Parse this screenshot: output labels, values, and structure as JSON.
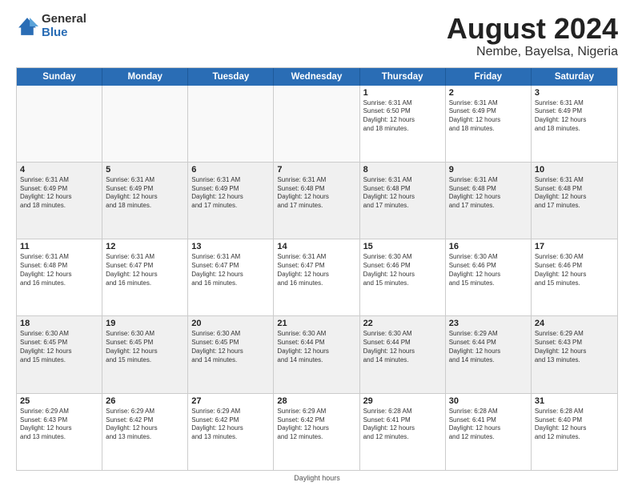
{
  "logo": {
    "general": "General",
    "blue": "Blue"
  },
  "title": "August 2024",
  "subtitle": "Nembe, Bayelsa, Nigeria",
  "days": [
    "Sunday",
    "Monday",
    "Tuesday",
    "Wednesday",
    "Thursday",
    "Friday",
    "Saturday"
  ],
  "footer": "Daylight hours",
  "weeks": [
    [
      {
        "day": "",
        "info": ""
      },
      {
        "day": "",
        "info": ""
      },
      {
        "day": "",
        "info": ""
      },
      {
        "day": "",
        "info": ""
      },
      {
        "day": "1",
        "info": "Sunrise: 6:31 AM\nSunset: 6:50 PM\nDaylight: 12 hours\nand 18 minutes."
      },
      {
        "day": "2",
        "info": "Sunrise: 6:31 AM\nSunset: 6:49 PM\nDaylight: 12 hours\nand 18 minutes."
      },
      {
        "day": "3",
        "info": "Sunrise: 6:31 AM\nSunset: 6:49 PM\nDaylight: 12 hours\nand 18 minutes."
      }
    ],
    [
      {
        "day": "4",
        "info": "Sunrise: 6:31 AM\nSunset: 6:49 PM\nDaylight: 12 hours\nand 18 minutes."
      },
      {
        "day": "5",
        "info": "Sunrise: 6:31 AM\nSunset: 6:49 PM\nDaylight: 12 hours\nand 18 minutes."
      },
      {
        "day": "6",
        "info": "Sunrise: 6:31 AM\nSunset: 6:49 PM\nDaylight: 12 hours\nand 17 minutes."
      },
      {
        "day": "7",
        "info": "Sunrise: 6:31 AM\nSunset: 6:48 PM\nDaylight: 12 hours\nand 17 minutes."
      },
      {
        "day": "8",
        "info": "Sunrise: 6:31 AM\nSunset: 6:48 PM\nDaylight: 12 hours\nand 17 minutes."
      },
      {
        "day": "9",
        "info": "Sunrise: 6:31 AM\nSunset: 6:48 PM\nDaylight: 12 hours\nand 17 minutes."
      },
      {
        "day": "10",
        "info": "Sunrise: 6:31 AM\nSunset: 6:48 PM\nDaylight: 12 hours\nand 17 minutes."
      }
    ],
    [
      {
        "day": "11",
        "info": "Sunrise: 6:31 AM\nSunset: 6:48 PM\nDaylight: 12 hours\nand 16 minutes."
      },
      {
        "day": "12",
        "info": "Sunrise: 6:31 AM\nSunset: 6:47 PM\nDaylight: 12 hours\nand 16 minutes."
      },
      {
        "day": "13",
        "info": "Sunrise: 6:31 AM\nSunset: 6:47 PM\nDaylight: 12 hours\nand 16 minutes."
      },
      {
        "day": "14",
        "info": "Sunrise: 6:31 AM\nSunset: 6:47 PM\nDaylight: 12 hours\nand 16 minutes."
      },
      {
        "day": "15",
        "info": "Sunrise: 6:30 AM\nSunset: 6:46 PM\nDaylight: 12 hours\nand 15 minutes."
      },
      {
        "day": "16",
        "info": "Sunrise: 6:30 AM\nSunset: 6:46 PM\nDaylight: 12 hours\nand 15 minutes."
      },
      {
        "day": "17",
        "info": "Sunrise: 6:30 AM\nSunset: 6:46 PM\nDaylight: 12 hours\nand 15 minutes."
      }
    ],
    [
      {
        "day": "18",
        "info": "Sunrise: 6:30 AM\nSunset: 6:45 PM\nDaylight: 12 hours\nand 15 minutes."
      },
      {
        "day": "19",
        "info": "Sunrise: 6:30 AM\nSunset: 6:45 PM\nDaylight: 12 hours\nand 15 minutes."
      },
      {
        "day": "20",
        "info": "Sunrise: 6:30 AM\nSunset: 6:45 PM\nDaylight: 12 hours\nand 14 minutes."
      },
      {
        "day": "21",
        "info": "Sunrise: 6:30 AM\nSunset: 6:44 PM\nDaylight: 12 hours\nand 14 minutes."
      },
      {
        "day": "22",
        "info": "Sunrise: 6:30 AM\nSunset: 6:44 PM\nDaylight: 12 hours\nand 14 minutes."
      },
      {
        "day": "23",
        "info": "Sunrise: 6:29 AM\nSunset: 6:44 PM\nDaylight: 12 hours\nand 14 minutes."
      },
      {
        "day": "24",
        "info": "Sunrise: 6:29 AM\nSunset: 6:43 PM\nDaylight: 12 hours\nand 13 minutes."
      }
    ],
    [
      {
        "day": "25",
        "info": "Sunrise: 6:29 AM\nSunset: 6:43 PM\nDaylight: 12 hours\nand 13 minutes."
      },
      {
        "day": "26",
        "info": "Sunrise: 6:29 AM\nSunset: 6:42 PM\nDaylight: 12 hours\nand 13 minutes."
      },
      {
        "day": "27",
        "info": "Sunrise: 6:29 AM\nSunset: 6:42 PM\nDaylight: 12 hours\nand 13 minutes."
      },
      {
        "day": "28",
        "info": "Sunrise: 6:29 AM\nSunset: 6:42 PM\nDaylight: 12 hours\nand 12 minutes."
      },
      {
        "day": "29",
        "info": "Sunrise: 6:28 AM\nSunset: 6:41 PM\nDaylight: 12 hours\nand 12 minutes."
      },
      {
        "day": "30",
        "info": "Sunrise: 6:28 AM\nSunset: 6:41 PM\nDaylight: 12 hours\nand 12 minutes."
      },
      {
        "day": "31",
        "info": "Sunrise: 6:28 AM\nSunset: 6:40 PM\nDaylight: 12 hours\nand 12 minutes."
      }
    ]
  ]
}
